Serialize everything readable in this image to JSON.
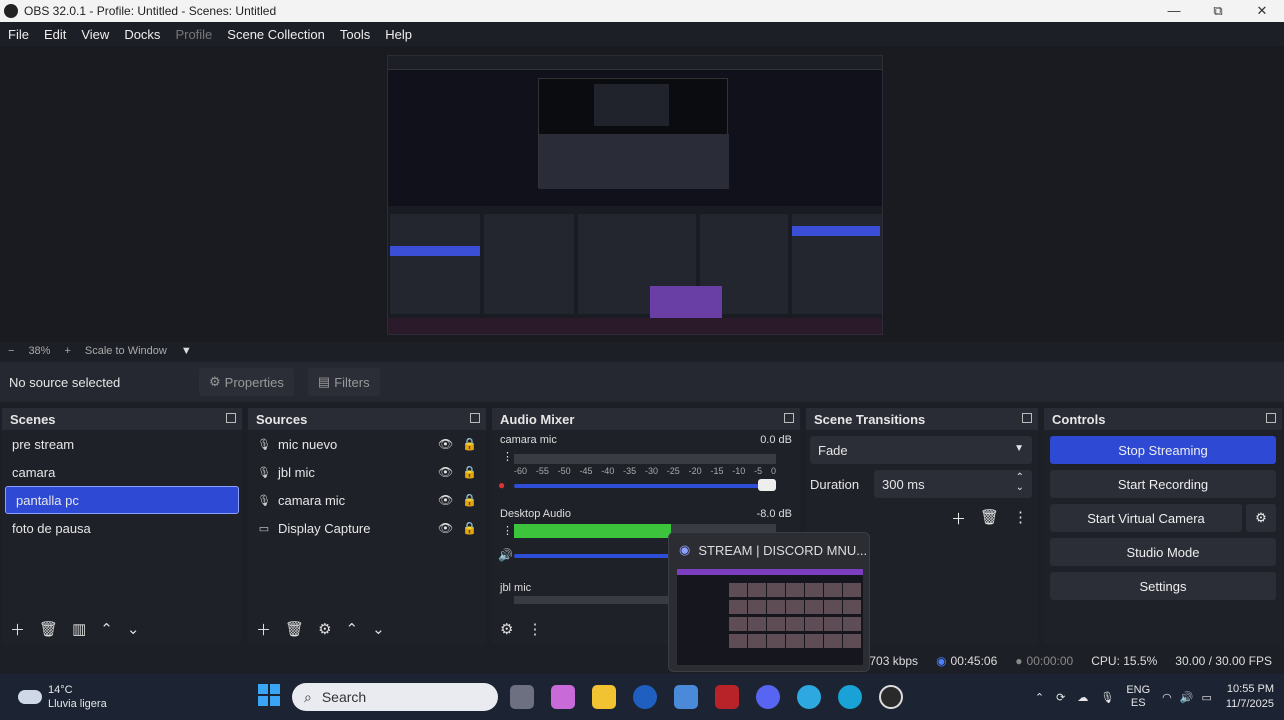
{
  "window": {
    "title": "OBS 32.0.1 - Profile: Untitled - Scenes: Untitled",
    "minimize": "—",
    "maximize": "⧉",
    "close": "✕"
  },
  "menu": [
    "File",
    "Edit",
    "View",
    "Docks",
    "Profile",
    "Scene Collection",
    "Tools",
    "Help"
  ],
  "zoom": {
    "minus": "−",
    "value": "38%",
    "plus": "+",
    "scale_mode": "Scale to Window",
    "dropdown": "▼"
  },
  "source_bar": {
    "no_source": "No source selected",
    "properties": "Properties",
    "filters": "Filters"
  },
  "scenes": {
    "title": "Scenes",
    "items": [
      "pre stream",
      "camara",
      "pantalla pc",
      "foto de pausa"
    ],
    "selected_index": 2
  },
  "sources": {
    "title": "Sources",
    "items": [
      {
        "name": "mic nuevo",
        "icon": "mic-icon"
      },
      {
        "name": "jbl mic",
        "icon": "mic-icon"
      },
      {
        "name": "camara mic",
        "icon": "mic-icon"
      },
      {
        "name": "Display Capture",
        "icon": "monitor-icon"
      }
    ]
  },
  "audio_mixer": {
    "title": "Audio Mixer",
    "channels": [
      {
        "name": "camara mic",
        "db": "0.0 dB",
        "level": 0.0,
        "muted": true
      },
      {
        "name": "Desktop Audio",
        "db": "-8.0 dB",
        "level": 0.6,
        "muted": false
      },
      {
        "name": "jbl mic",
        "db": "",
        "level": 0.0,
        "muted": false
      }
    ],
    "ticks": [
      "-60",
      "-55",
      "-50",
      "-45",
      "-40",
      "-35",
      "-30",
      "-25",
      "-20",
      "-15",
      "-10",
      "-5",
      "0"
    ]
  },
  "transitions": {
    "title": "Scene Transitions",
    "type": "Fade",
    "duration_label": "Duration",
    "duration": "300 ms"
  },
  "controls": {
    "title": "Controls",
    "stop_streaming": "Stop Streaming",
    "start_recording": "Start Recording",
    "start_virtual_camera": "Start Virtual Camera",
    "studio_mode": "Studio Mode",
    "settings": "Settings"
  },
  "status": {
    "bitrate": "2703 kbps",
    "stream_time": "00:45:06",
    "rec_time": "00:00:00",
    "cpu": "CPU: 15.5%",
    "fps": "30.00 / 30.00 FPS"
  },
  "popup": {
    "title": "STREAM | DISCORD MNU..."
  },
  "taskbar": {
    "weather_temp": "14°C",
    "weather_desc": "Lluvia ligera",
    "search_placeholder": "Search",
    "lang_top": "ENG",
    "lang_bottom": "ES",
    "time": "10:55 PM",
    "date": "11/7/2025"
  },
  "colors": {
    "accent": "#2e4ad4",
    "meter_green": "#3cc43c",
    "bg": "#1d1f26"
  }
}
